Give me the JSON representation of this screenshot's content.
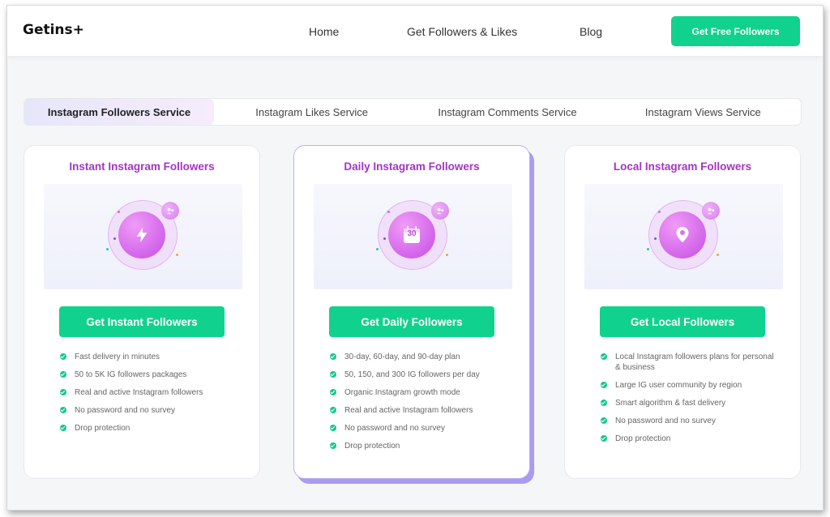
{
  "nav": {
    "logo": "Getins+",
    "links": [
      "Home",
      "Get Followers & Likes",
      "Blog"
    ],
    "cta": "Get Free Followers"
  },
  "tabs": [
    {
      "label": "Instagram Followers Service",
      "active": true
    },
    {
      "label": "Instagram Likes Service",
      "active": false
    },
    {
      "label": "Instagram Comments Service",
      "active": false
    },
    {
      "label": "Instagram Views Service",
      "active": false
    }
  ],
  "cards": [
    {
      "title": "Instant Instagram Followers",
      "icon": "lightning-icon",
      "button": "Get Instant Followers",
      "features": [
        "Fast delivery in minutes",
        "50 to 5K IG followers packages",
        "Real and active Instagram followers",
        "No password and no survey",
        "Drop protection"
      ]
    },
    {
      "title": "Daily Instagram Followers",
      "icon": "calendar-icon",
      "calendar_number": "30",
      "button": "Get Daily Followers",
      "features": [
        "30-day, 60-day, and 90-day plan",
        "50, 150, and 300 IG followers per day",
        "Organic Instagram growth mode",
        "Real and active Instagram followers",
        "No password and no survey",
        "Drop protection"
      ]
    },
    {
      "title": "Local Instagram Followers",
      "icon": "location-pin-icon",
      "button": "Get Local Followers",
      "features": [
        "Local Instagram followers plans for personal & business",
        "Large IG user community by region",
        "Smart algorithm & fast delivery",
        "No password and no survey",
        "Drop protection"
      ]
    }
  ],
  "colors": {
    "accent_green": "#10d28e",
    "title_purple": "#a533c7",
    "featured_border": "#a99af2"
  }
}
